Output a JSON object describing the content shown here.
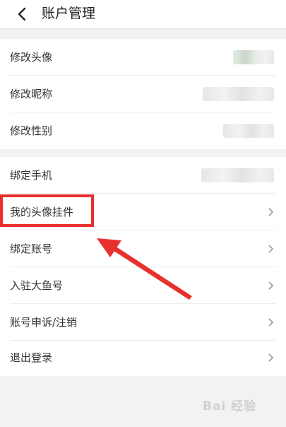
{
  "header": {
    "title": "账户管理",
    "back_icon": "chevron-left-icon"
  },
  "profile_group": [
    {
      "label": "修改头像"
    },
    {
      "label": "修改昵称"
    },
    {
      "label": "修改性别"
    }
  ],
  "account_group": [
    {
      "label": "绑定手机"
    },
    {
      "label": "我的头像挂件"
    },
    {
      "label": "绑定账号"
    },
    {
      "label": "入驻大鱼号"
    },
    {
      "label": "账号申诉/注销"
    },
    {
      "label": "退出登录"
    }
  ],
  "annotation": {
    "highlight_color": "#e8312f"
  },
  "watermark": {
    "text": "Bai 经验"
  }
}
